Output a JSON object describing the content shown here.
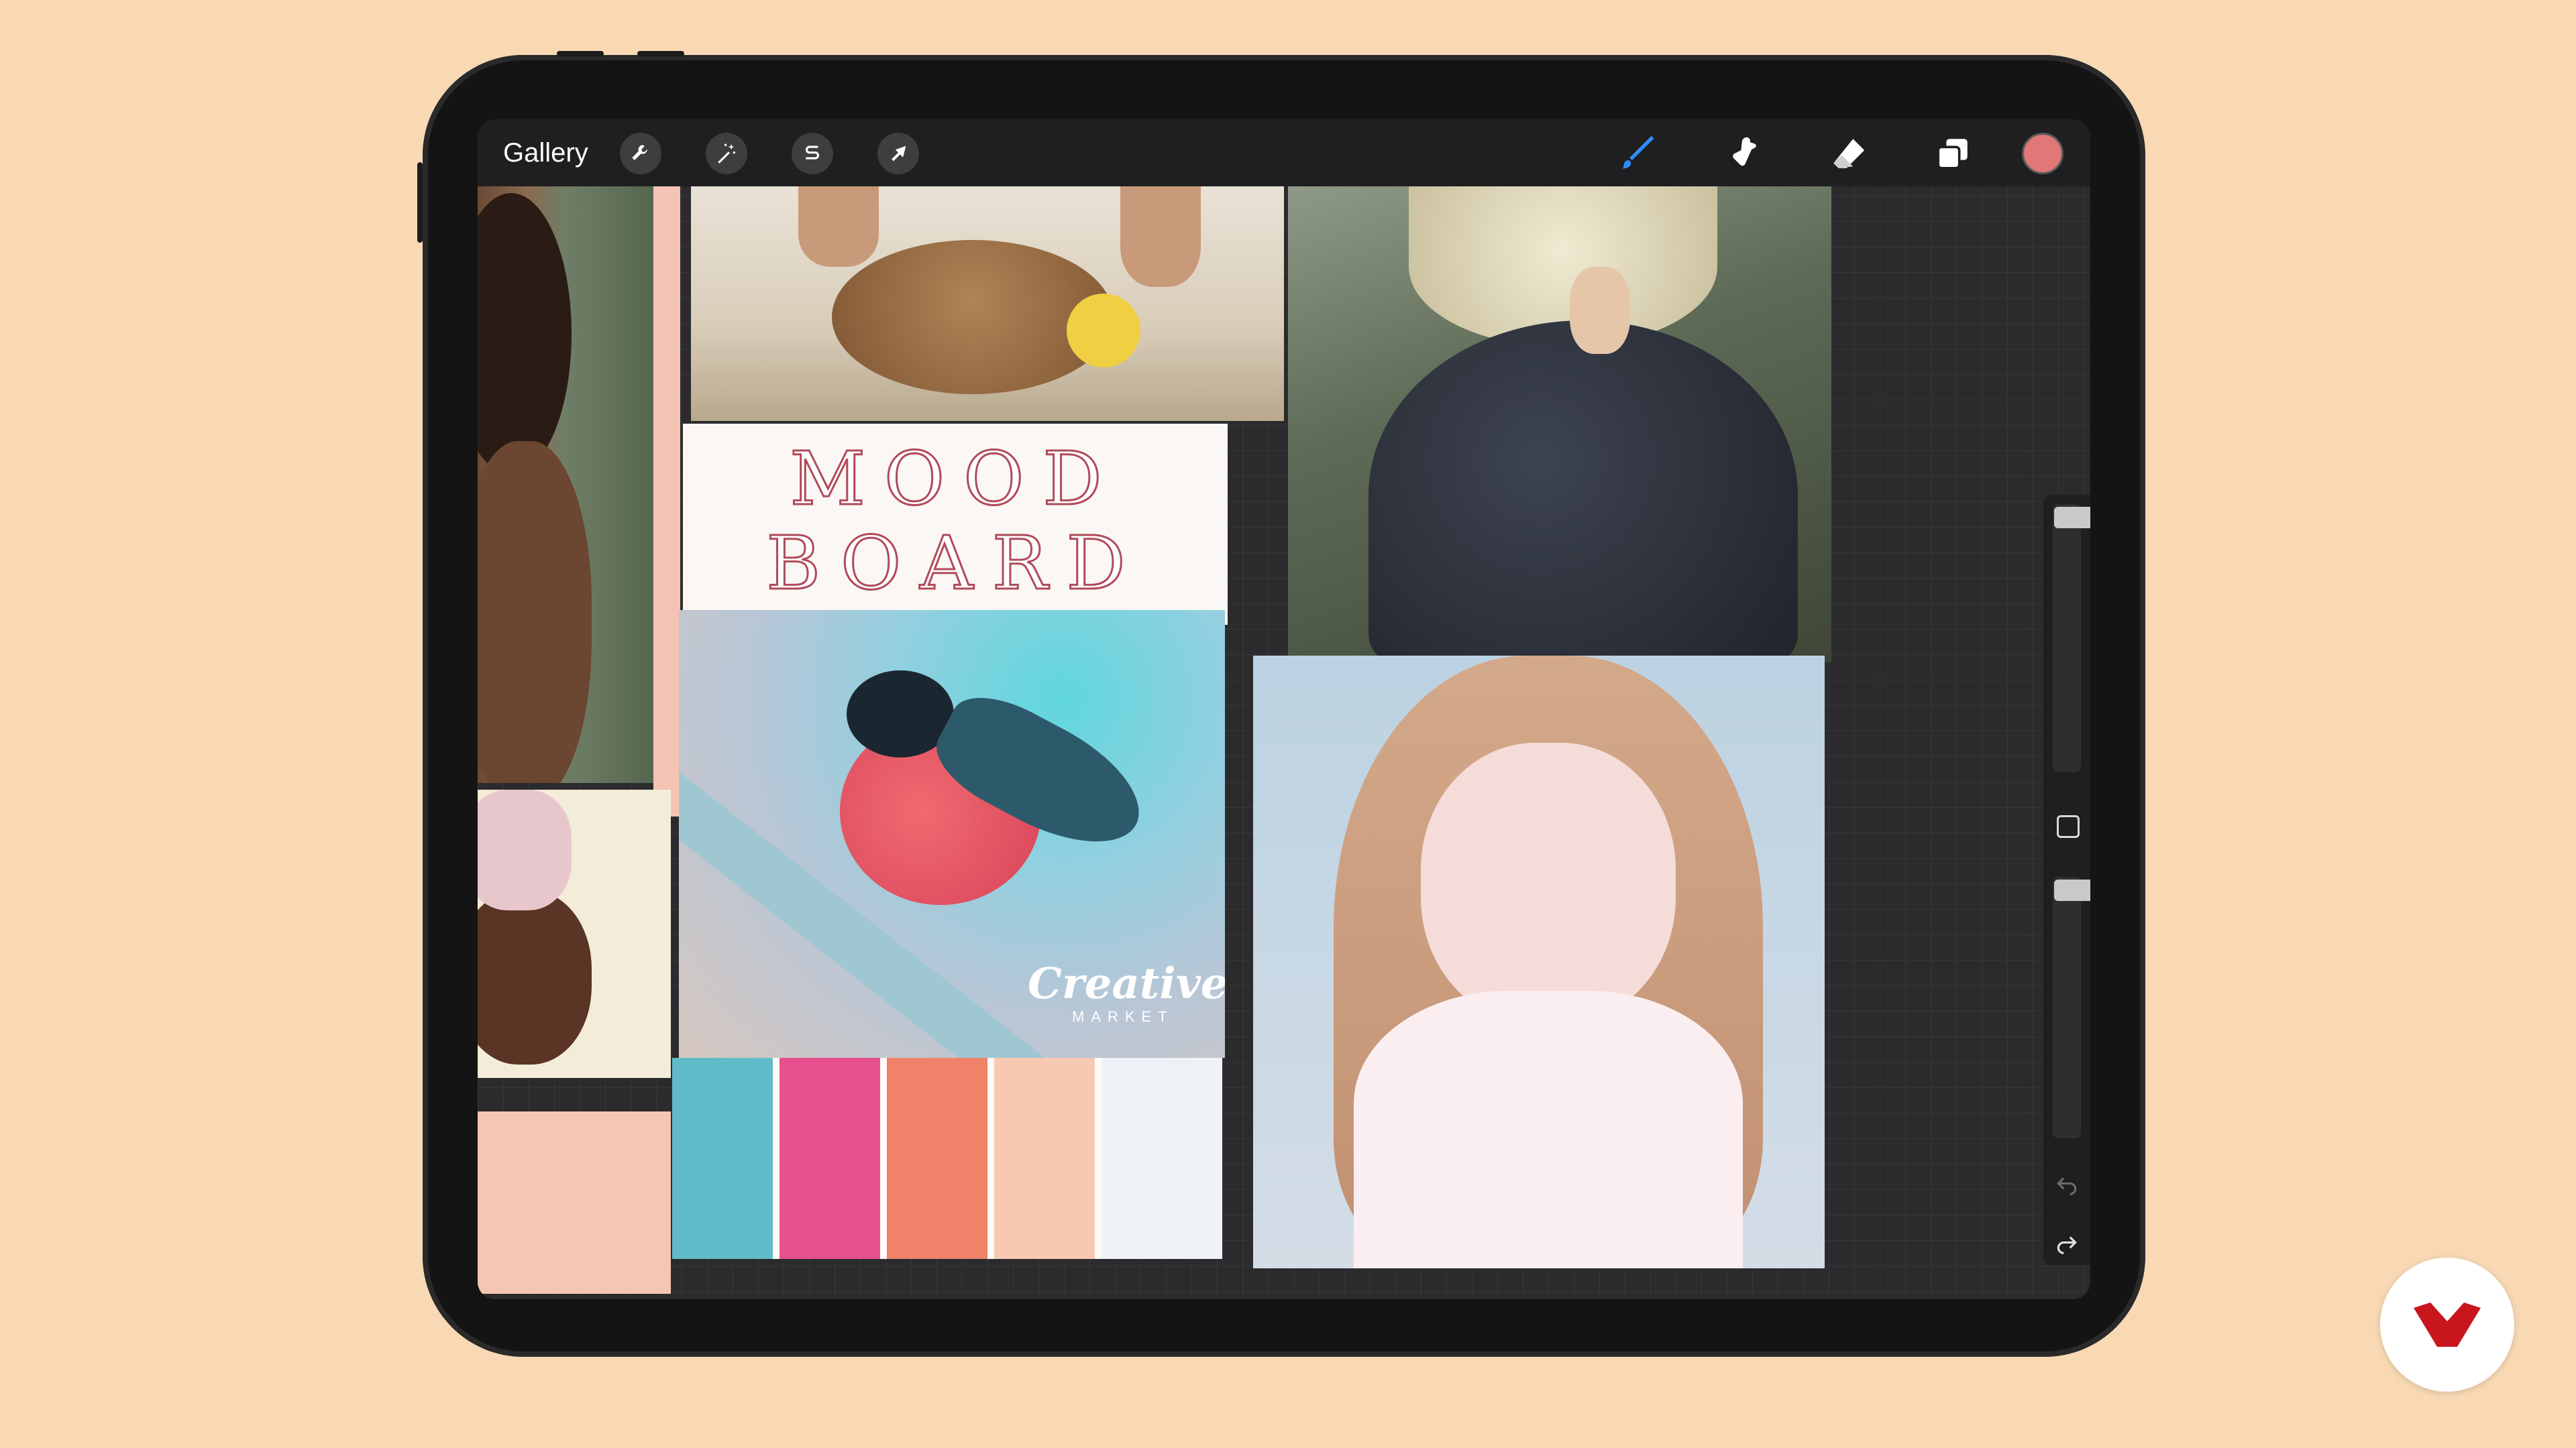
{
  "toolbar": {
    "gallery_label": "Gallery",
    "actions_icon": "wrench-icon",
    "adjustments_icon": "magic-wand-icon",
    "selection_icon": "selection-s-icon",
    "transform_icon": "arrow-cursor-icon",
    "brush_icon": "brush-icon",
    "smudge_icon": "smudge-icon",
    "eraser_icon": "eraser-icon",
    "layers_icon": "layers-icon",
    "current_color": "#e07878"
  },
  "canvas": {
    "mood_board": {
      "line1": "MOOD",
      "line2": "BOARD"
    },
    "watermark": {
      "line1": "Creative",
      "line2": "MARKET"
    },
    "palette": [
      "#5fbcc8",
      "#e6508c",
      "#ef8268",
      "#f7c9b3",
      "#eef2f6"
    ]
  },
  "sidebar": {
    "brush_size_level": 0.95,
    "opacity_level": 0.95
  },
  "brand": {
    "accent": "#c8161d"
  }
}
